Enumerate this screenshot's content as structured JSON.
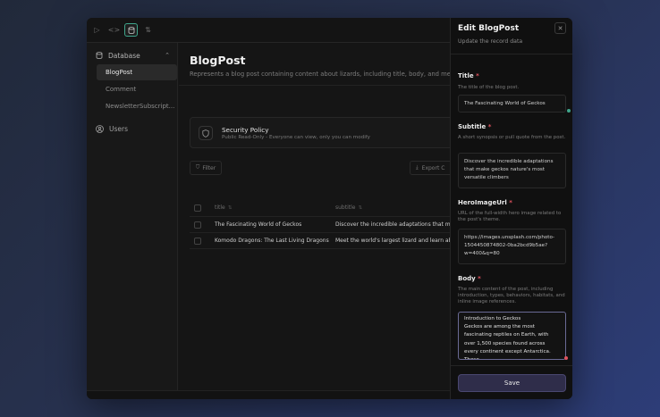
{
  "toolbar": {
    "icons": [
      "play-icon",
      "code-icon",
      "database-icon",
      "git-compare-icon"
    ]
  },
  "sidebar": {
    "section": {
      "label": "Database",
      "icon": "database-icon"
    },
    "items": [
      {
        "label": "BlogPost",
        "active": true
      },
      {
        "label": "Comment",
        "active": false
      },
      {
        "label": "NewsletterSubscript...",
        "active": false
      }
    ],
    "users": {
      "label": "Users",
      "icon": "user-circle-icon"
    }
  },
  "main": {
    "title": "BlogPost",
    "description": "Represents a blog post containing content about lizards, including title, body, and metadat",
    "security": {
      "title": "Security Policy",
      "subtitle": "Public Read-Only - Everyone can view, only you can modify",
      "icon": "shield-icon"
    },
    "filter_label": "Filter",
    "export_label": "Export C",
    "table": {
      "columns": [
        "title",
        "subtitle"
      ],
      "rows": [
        {
          "title": "The Fascinating World of Geckos",
          "subtitle": "Discover the incredible adaptations that make"
        },
        {
          "title": "Komodo Dragons: The Last Living Dragons",
          "subtitle": "Meet the world's largest lizard and learn abou"
        }
      ]
    }
  },
  "panel": {
    "title": "Edit BlogPost",
    "subtitle": "Update the record data",
    "close_icon": "close-icon",
    "fields": {
      "title": {
        "label": "Title",
        "required": "*",
        "description": "The title of the blog post.",
        "value": "The Fascinating World of Geckos"
      },
      "subtitle": {
        "label": "Subtitle",
        "required": "*",
        "description": "A short synopsis or pull quote from the post.",
        "value": "Discover the incredible adaptations that make geckos nature's most versatile climbers"
      },
      "hero": {
        "label": "HeroImageUrl",
        "required": "*",
        "description": "URL of the full-width hero image related to the post's theme.",
        "value": "https://images.unsplash.com/photo-1504450874802-0ba2bcd9b5ae?w=400&q=80"
      },
      "body": {
        "label": "Body",
        "required": "*",
        "description": "The main content of the post, including introduction, types, behaviors, habitats, and inline image references.",
        "value": "Introduction to Geckos\nGeckos are among the most fascinating reptiles on Earth, with over 1,500 species found across every continent except Antarctica. These"
      }
    },
    "save_label": "Save"
  },
  "colors": {
    "accent": "#3fa58b",
    "required": "#e0525e",
    "save_button": "#2f2d4a"
  }
}
